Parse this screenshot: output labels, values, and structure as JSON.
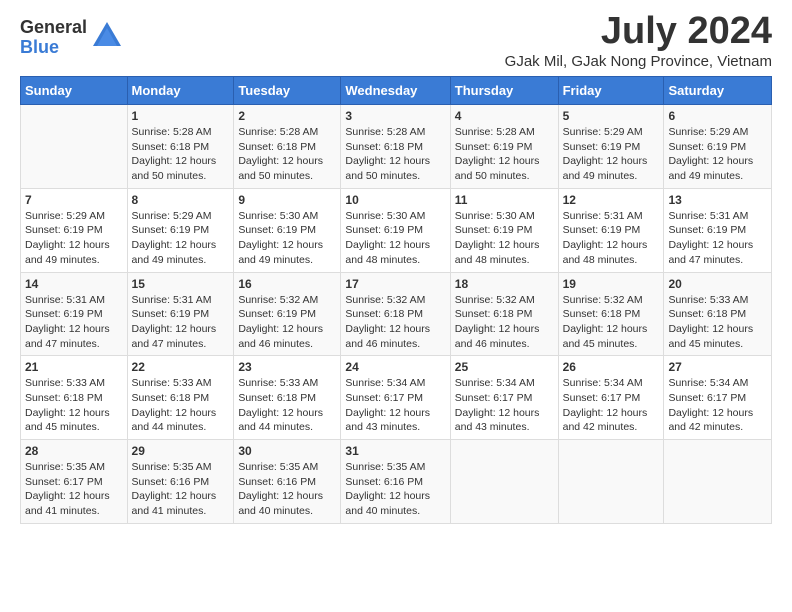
{
  "logo": {
    "general": "General",
    "blue": "Blue"
  },
  "title": {
    "month_year": "July 2024",
    "location": "GJak Mil, GJak Nong Province, Vietnam"
  },
  "days_of_week": [
    "Sunday",
    "Monday",
    "Tuesday",
    "Wednesday",
    "Thursday",
    "Friday",
    "Saturday"
  ],
  "weeks": [
    [
      {
        "day": "",
        "sunrise": "",
        "sunset": "",
        "daylight": ""
      },
      {
        "day": "1",
        "sunrise": "Sunrise: 5:28 AM",
        "sunset": "Sunset: 6:18 PM",
        "daylight": "Daylight: 12 hours and 50 minutes."
      },
      {
        "day": "2",
        "sunrise": "Sunrise: 5:28 AM",
        "sunset": "Sunset: 6:18 PM",
        "daylight": "Daylight: 12 hours and 50 minutes."
      },
      {
        "day": "3",
        "sunrise": "Sunrise: 5:28 AM",
        "sunset": "Sunset: 6:18 PM",
        "daylight": "Daylight: 12 hours and 50 minutes."
      },
      {
        "day": "4",
        "sunrise": "Sunrise: 5:28 AM",
        "sunset": "Sunset: 6:19 PM",
        "daylight": "Daylight: 12 hours and 50 minutes."
      },
      {
        "day": "5",
        "sunrise": "Sunrise: 5:29 AM",
        "sunset": "Sunset: 6:19 PM",
        "daylight": "Daylight: 12 hours and 49 minutes."
      },
      {
        "day": "6",
        "sunrise": "Sunrise: 5:29 AM",
        "sunset": "Sunset: 6:19 PM",
        "daylight": "Daylight: 12 hours and 49 minutes."
      }
    ],
    [
      {
        "day": "7",
        "sunrise": "Sunrise: 5:29 AM",
        "sunset": "Sunset: 6:19 PM",
        "daylight": "Daylight: 12 hours and 49 minutes."
      },
      {
        "day": "8",
        "sunrise": "Sunrise: 5:29 AM",
        "sunset": "Sunset: 6:19 PM",
        "daylight": "Daylight: 12 hours and 49 minutes."
      },
      {
        "day": "9",
        "sunrise": "Sunrise: 5:30 AM",
        "sunset": "Sunset: 6:19 PM",
        "daylight": "Daylight: 12 hours and 49 minutes."
      },
      {
        "day": "10",
        "sunrise": "Sunrise: 5:30 AM",
        "sunset": "Sunset: 6:19 PM",
        "daylight": "Daylight: 12 hours and 48 minutes."
      },
      {
        "day": "11",
        "sunrise": "Sunrise: 5:30 AM",
        "sunset": "Sunset: 6:19 PM",
        "daylight": "Daylight: 12 hours and 48 minutes."
      },
      {
        "day": "12",
        "sunrise": "Sunrise: 5:31 AM",
        "sunset": "Sunset: 6:19 PM",
        "daylight": "Daylight: 12 hours and 48 minutes."
      },
      {
        "day": "13",
        "sunrise": "Sunrise: 5:31 AM",
        "sunset": "Sunset: 6:19 PM",
        "daylight": "Daylight: 12 hours and 47 minutes."
      }
    ],
    [
      {
        "day": "14",
        "sunrise": "Sunrise: 5:31 AM",
        "sunset": "Sunset: 6:19 PM",
        "daylight": "Daylight: 12 hours and 47 minutes."
      },
      {
        "day": "15",
        "sunrise": "Sunrise: 5:31 AM",
        "sunset": "Sunset: 6:19 PM",
        "daylight": "Daylight: 12 hours and 47 minutes."
      },
      {
        "day": "16",
        "sunrise": "Sunrise: 5:32 AM",
        "sunset": "Sunset: 6:19 PM",
        "daylight": "Daylight: 12 hours and 46 minutes."
      },
      {
        "day": "17",
        "sunrise": "Sunrise: 5:32 AM",
        "sunset": "Sunset: 6:18 PM",
        "daylight": "Daylight: 12 hours and 46 minutes."
      },
      {
        "day": "18",
        "sunrise": "Sunrise: 5:32 AM",
        "sunset": "Sunset: 6:18 PM",
        "daylight": "Daylight: 12 hours and 46 minutes."
      },
      {
        "day": "19",
        "sunrise": "Sunrise: 5:32 AM",
        "sunset": "Sunset: 6:18 PM",
        "daylight": "Daylight: 12 hours and 45 minutes."
      },
      {
        "day": "20",
        "sunrise": "Sunrise: 5:33 AM",
        "sunset": "Sunset: 6:18 PM",
        "daylight": "Daylight: 12 hours and 45 minutes."
      }
    ],
    [
      {
        "day": "21",
        "sunrise": "Sunrise: 5:33 AM",
        "sunset": "Sunset: 6:18 PM",
        "daylight": "Daylight: 12 hours and 45 minutes."
      },
      {
        "day": "22",
        "sunrise": "Sunrise: 5:33 AM",
        "sunset": "Sunset: 6:18 PM",
        "daylight": "Daylight: 12 hours and 44 minutes."
      },
      {
        "day": "23",
        "sunrise": "Sunrise: 5:33 AM",
        "sunset": "Sunset: 6:18 PM",
        "daylight": "Daylight: 12 hours and 44 minutes."
      },
      {
        "day": "24",
        "sunrise": "Sunrise: 5:34 AM",
        "sunset": "Sunset: 6:17 PM",
        "daylight": "Daylight: 12 hours and 43 minutes."
      },
      {
        "day": "25",
        "sunrise": "Sunrise: 5:34 AM",
        "sunset": "Sunset: 6:17 PM",
        "daylight": "Daylight: 12 hours and 43 minutes."
      },
      {
        "day": "26",
        "sunrise": "Sunrise: 5:34 AM",
        "sunset": "Sunset: 6:17 PM",
        "daylight": "Daylight: 12 hours and 42 minutes."
      },
      {
        "day": "27",
        "sunrise": "Sunrise: 5:34 AM",
        "sunset": "Sunset: 6:17 PM",
        "daylight": "Daylight: 12 hours and 42 minutes."
      }
    ],
    [
      {
        "day": "28",
        "sunrise": "Sunrise: 5:35 AM",
        "sunset": "Sunset: 6:17 PM",
        "daylight": "Daylight: 12 hours and 41 minutes."
      },
      {
        "day": "29",
        "sunrise": "Sunrise: 5:35 AM",
        "sunset": "Sunset: 6:16 PM",
        "daylight": "Daylight: 12 hours and 41 minutes."
      },
      {
        "day": "30",
        "sunrise": "Sunrise: 5:35 AM",
        "sunset": "Sunset: 6:16 PM",
        "daylight": "Daylight: 12 hours and 40 minutes."
      },
      {
        "day": "31",
        "sunrise": "Sunrise: 5:35 AM",
        "sunset": "Sunset: 6:16 PM",
        "daylight": "Daylight: 12 hours and 40 minutes."
      },
      {
        "day": "",
        "sunrise": "",
        "sunset": "",
        "daylight": ""
      },
      {
        "day": "",
        "sunrise": "",
        "sunset": "",
        "daylight": ""
      },
      {
        "day": "",
        "sunrise": "",
        "sunset": "",
        "daylight": ""
      }
    ]
  ]
}
